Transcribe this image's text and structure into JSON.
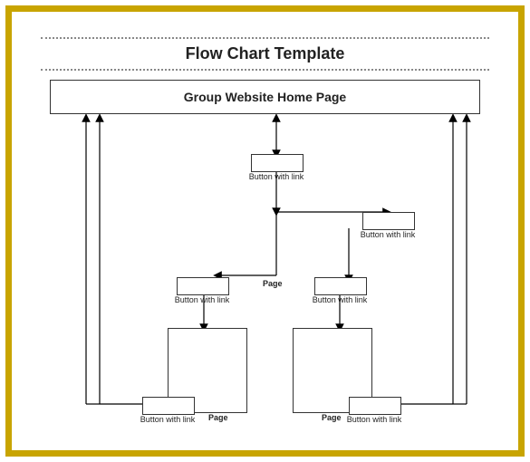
{
  "title": "Flow Chart Template",
  "hero": "Group Website Home Page",
  "labels": {
    "btn_link": "Button with link",
    "page": "Page"
  }
}
